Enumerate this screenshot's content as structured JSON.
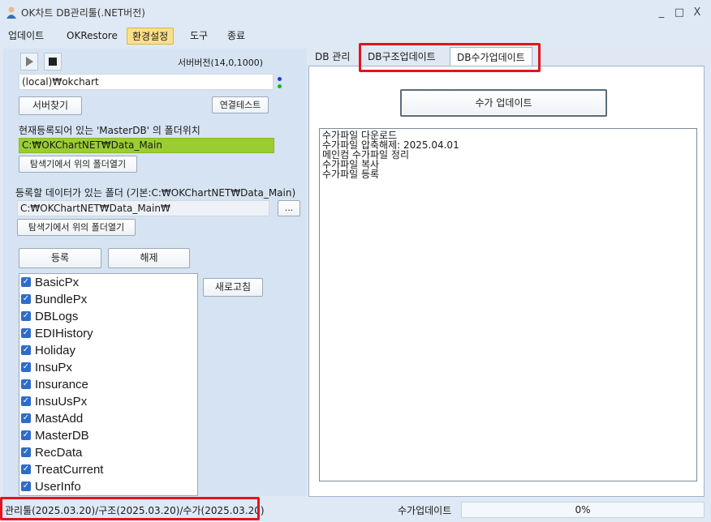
{
  "window": {
    "title": "OK차트 DB관리툴(.NET버전)",
    "minimize_glyph": "_",
    "maximize_glyph": "□",
    "close_glyph": "X"
  },
  "menu": {
    "items": [
      "업데이트",
      "OKRestore",
      "환경설정",
      "도구",
      "종료"
    ],
    "active_index": 2
  },
  "server": {
    "version_label": "서버버전(14,0,1000)",
    "instance_value": "(local)₩okchart",
    "find_server_button": "서버찾기",
    "test_connection_button": "연결테스트"
  },
  "master_db": {
    "label": "현재등록되어 있는 'MasterDB' 의 폴더위치",
    "path_value": "C:₩OKChartNET₩Data_Main",
    "open_folder_button": "탐색기에서 위의 폴더열기"
  },
  "data_folder": {
    "label": "등록할 데이터가 있는 폴더 (기본:C:₩OKChartNET₩Data_Main)",
    "path_value": "C:₩OKChartNET₩Data_Main₩",
    "browse_button": "...",
    "open_folder_button": "탐색기에서 위의 폴더열기"
  },
  "actions": {
    "register_button": "등록",
    "unregister_button": "해제",
    "refresh_button": "새로고침"
  },
  "db_list": {
    "items": [
      "BasicPx",
      "BundlePx",
      "DBLogs",
      "EDIHistory",
      "Holiday",
      "InsuPx",
      "Insurance",
      "InsuUsPx",
      "MastAdd",
      "MasterDB",
      "RecData",
      "TreatCurrent",
      "UserInfo"
    ]
  },
  "tabs": {
    "items": [
      "DB 관리",
      "DB구조업데이트",
      "DB수가업데이트"
    ],
    "selected_index": 2
  },
  "fee_update": {
    "button": "수가 업데이트",
    "log_lines": [
      "수가파일 다운로드",
      "수가파일 압축해제: 2025.04.01",
      "메인컴 수가파일 정리",
      "수가파일 복사",
      "수가파일 등록"
    ]
  },
  "status": {
    "version_text": "관리툴(2025.03.20)/구조(2025.03.20)/수가(2025.03.20)",
    "task_text": "수가업데이트",
    "progress_text": "0%"
  },
  "colors": {
    "highlight_field": "#9acd32",
    "annotation_red": "#e3141b",
    "menu_active": "#fbe08a",
    "checkbox": "#2e6cc9"
  }
}
